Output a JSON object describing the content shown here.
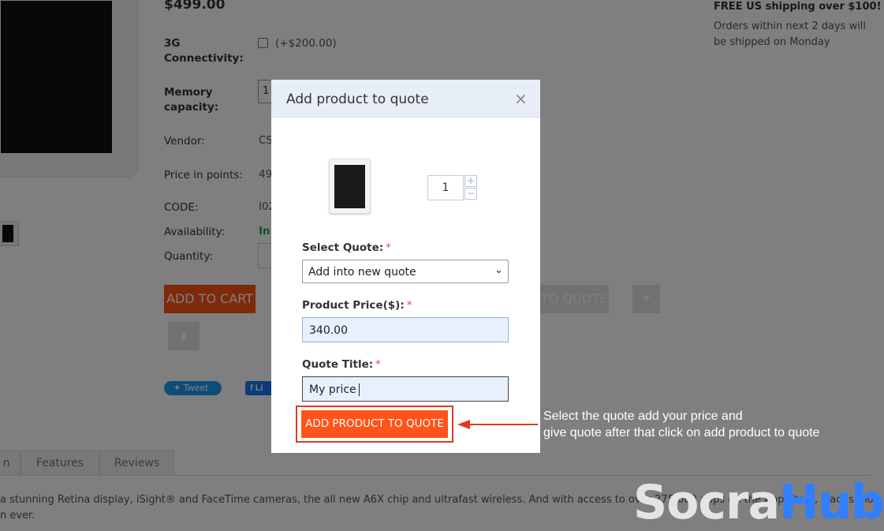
{
  "product": {
    "price": "$499.00",
    "options": {
      "connectivity_label": "3G Connectivity:",
      "connectivity_price": "(+$200.00)",
      "memory_label": "Memory capacity:",
      "memory_value": "1",
      "vendor_label": "Vendor:",
      "vendor_value": "CS",
      "points_label": "Price in points:",
      "points_value": "49",
      "code_label": "CODE:",
      "code_value": "I02",
      "availability_label": "Availability:",
      "availability_value": "In",
      "quantity_label": "Quantity:"
    },
    "buttons": {
      "add_to_cart": "ADD TO CART",
      "add_to_quote": "TO QUOTE",
      "wishlist_icon": "heart-icon",
      "compare_icon": "bar-chart-icon",
      "tweet": "Tweet",
      "facebook": "Li"
    },
    "shipping": {
      "headline": "FREE US shipping over $100!",
      "note": "Orders within next 2 days will be shipped on Monday"
    },
    "tabs": [
      "n",
      "Features",
      "Reviews"
    ],
    "description_line1": "a stunning Retina display, iSight® and FaceTime cameras, the all new A6X chip and ultrafast wireless. And with access to over 275,000 apps on the App Store, iPad is more capable and fun to use than",
    "description_line2": "n ever."
  },
  "modal": {
    "title": "Add product to quote",
    "close": "×",
    "quantity": "1",
    "plus": "+",
    "minus": "−",
    "select_quote_label": "Select Quote:",
    "select_quote_value": "Add into new quote",
    "product_price_label": "Product Price($):",
    "product_price_value": "340.00",
    "quote_title_label": "Quote Title:",
    "quote_title_value": "My price",
    "required_marker": "*",
    "submit": "ADD PRODUCT TO QUOTE"
  },
  "annotation": {
    "line1": "Select the quote add your price and",
    "line2": "give quote after that click on add product to quote",
    "color": "#e13b1c"
  },
  "watermark": {
    "part1": "Socra",
    "part2": "Hub"
  },
  "colors": {
    "accent": "#ff5319",
    "overlay": "rgba(0,0,0,0.5)",
    "required": "#e04b3a"
  }
}
